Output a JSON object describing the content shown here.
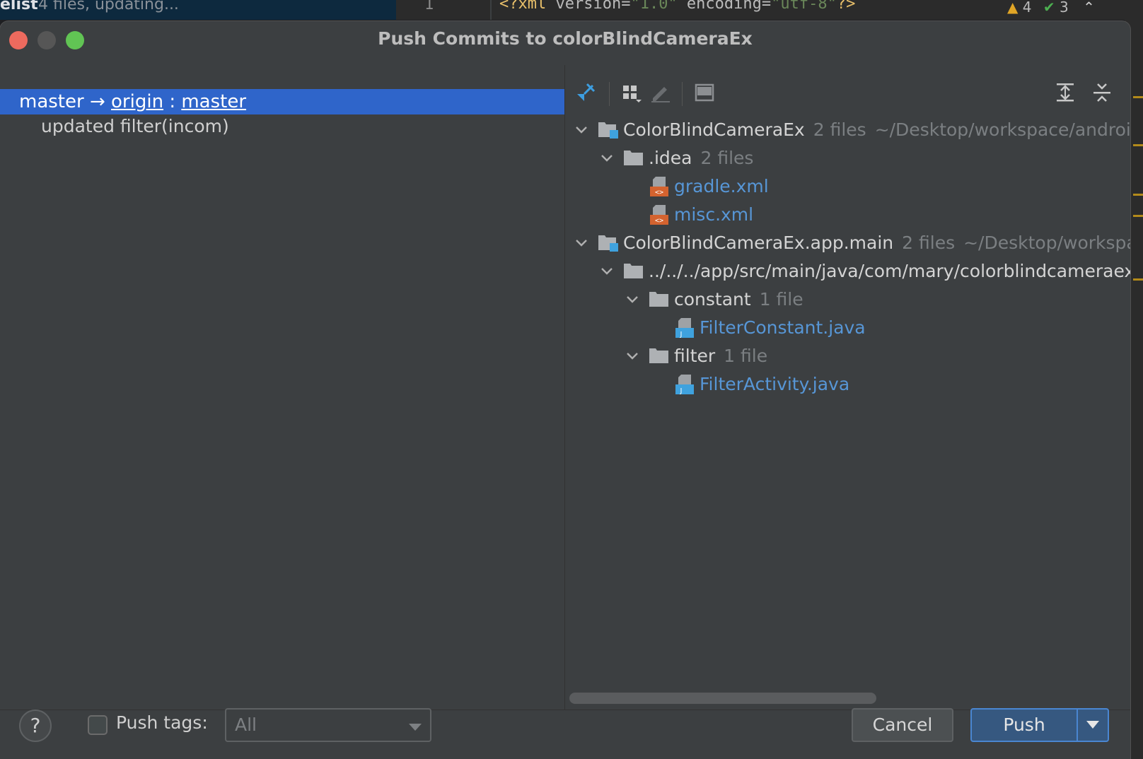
{
  "background": {
    "changelist_label": "elist",
    "changelist_status": "4 files, updating...",
    "line_number": "1",
    "code": {
      "open": "<?xml ",
      "attr1": "version=",
      "val1": "\"1.0\"",
      "attr2": " encoding=",
      "val2": "\"utf-8\"",
      "close": "?>"
    },
    "warnings": "4",
    "checks": "3"
  },
  "dialog": {
    "title": "Push Commits to colorBlindCameraEx"
  },
  "branches": {
    "local": "master",
    "arrow": "→",
    "remote": "origin",
    "separator": ":",
    "remote_branch": "master"
  },
  "commits": [
    {
      "message": "updated filter(incom)"
    }
  ],
  "tree": [
    {
      "name": "ColorBlindCameraEx",
      "count": "2 files",
      "path": "~/Desktop/workspace/androi"
    },
    {
      "name": ".idea",
      "count": "2 files"
    },
    {
      "name": "gradle.xml"
    },
    {
      "name": "misc.xml"
    },
    {
      "name": "ColorBlindCameraEx.app.main",
      "count": "2 files",
      "path": "~/Desktop/workspa"
    },
    {
      "name": "../../../app/src/main/java/com/mary/colorblindcameraex"
    },
    {
      "name": "constant",
      "count": "1 file"
    },
    {
      "name": "FilterConstant.java"
    },
    {
      "name": "filter",
      "count": "1 file"
    },
    {
      "name": "FilterActivity.java"
    }
  ],
  "footer": {
    "help": "?",
    "push_tags_label": "Push tags:",
    "push_tags_value": "All",
    "cancel": "Cancel",
    "push": "Push"
  },
  "colors": {
    "selection": "#2f65ca",
    "file_link": "#5796d6",
    "primary_button": "#365880"
  },
  "icons": {
    "toolbar": [
      "pin-icon",
      "group-by-icon",
      "edit-icon",
      "preview-diff-icon",
      "expand-all-icon",
      "collapse-all-icon"
    ],
    "tree": [
      "module-icon",
      "folder-icon",
      "xml-file-icon",
      "java-file-icon"
    ]
  }
}
